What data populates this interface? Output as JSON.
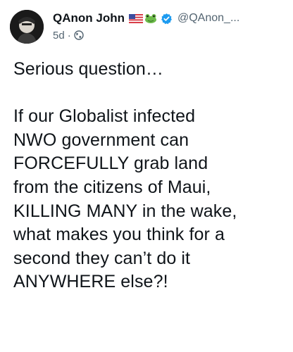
{
  "author": {
    "display_name": "QAnon John",
    "handle": "@QAnon_...",
    "time_ago": "5d",
    "separator": "·",
    "flag_icon": "us-flag-icon",
    "badge_icon": "frog-emoji-icon",
    "verified_icon": "verified-badge-icon",
    "audience_icon": "globe-icon"
  },
  "tweet": {
    "paragraph1": [
      "Serious question…"
    ],
    "paragraph2": [
      "If our Globalist infected",
      "NWO government can",
      "FORCEFULLY grab land",
      "from the citizens of Maui,",
      "KILLING MANY in the wake,",
      "what makes you think for a",
      "second they can’t do it",
      "ANYWHERE else?!"
    ]
  },
  "colors": {
    "text": "#0f1419",
    "secondary": "#536471",
    "verified": "#1d9bf0",
    "background": "#ffffff"
  }
}
